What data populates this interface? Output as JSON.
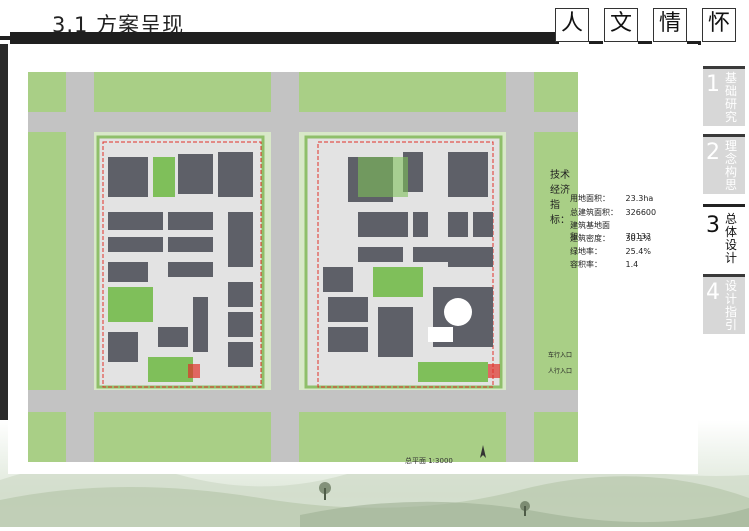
{
  "header": {
    "title": "3.1 方案呈现",
    "chars": [
      "人",
      "文",
      "情",
      "怀"
    ]
  },
  "tabs": [
    {
      "num": "1",
      "label": "基础研究",
      "active": false
    },
    {
      "num": "2",
      "label": "理念构思",
      "active": false
    },
    {
      "num": "3",
      "label": "总体设计",
      "active": true
    },
    {
      "num": "4",
      "label": "设计指引",
      "active": false
    }
  ],
  "indicators": {
    "title": "技术经济指标：",
    "items": [
      {
        "key": "用地面积：",
        "value": "23.3ha"
      },
      {
        "key": "总建筑面积：",
        "value": "326600"
      },
      {
        "key": "建筑基地面积：",
        "value": "70133"
      },
      {
        "key": "建筑密度：",
        "value": "30.1%"
      },
      {
        "key": "绿地率：",
        "value": "25.4%"
      },
      {
        "key": "容积率：",
        "value": "1.4"
      }
    ]
  },
  "plan": {
    "scale": "总平面 1:3000",
    "legend": [
      "车行入口",
      "人行入口"
    ]
  },
  "colors": {
    "road": "#bfbfbf",
    "green": "#7fbf5a",
    "building": "#5e6068",
    "boundary": "#e0312a"
  }
}
